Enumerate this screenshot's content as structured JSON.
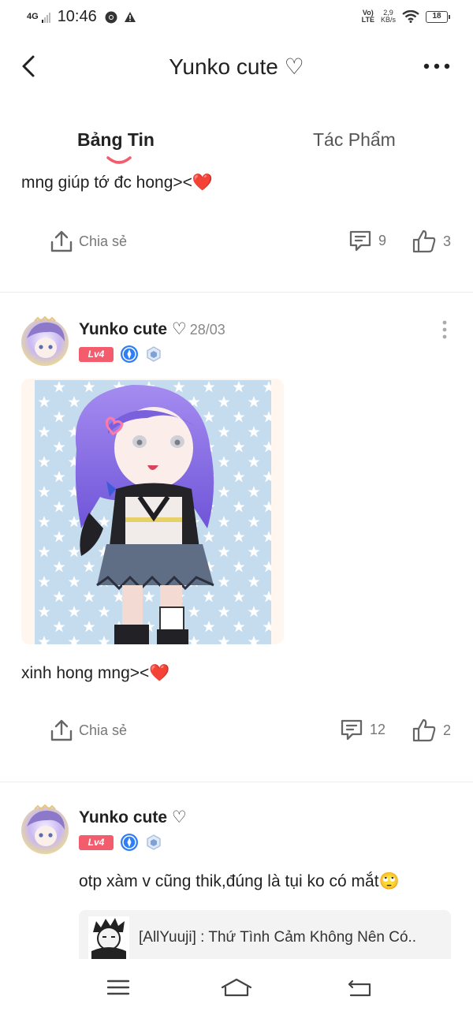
{
  "status_bar": {
    "signal": "4G",
    "time": "10:46",
    "volte_line1": "Vo)",
    "volte_line2": "LTE",
    "speed_value": "2,9",
    "speed_unit": "KB/s",
    "battery": "18"
  },
  "header": {
    "title": "Yunko cute ♡"
  },
  "tabs": [
    {
      "label": "Bảng Tin",
      "active": true
    },
    {
      "label": "Tác Phẩm",
      "active": false
    }
  ],
  "colors": {
    "accent": "#f25c6c",
    "badge_blue": "#2f7ef6",
    "text": "#222222",
    "muted": "#777777"
  },
  "posts": [
    {
      "text": "mng giúp tớ đc hong><❤️",
      "share_label": "Chia sẻ",
      "comments": "9",
      "likes": "3"
    },
    {
      "author": "Yunko cute ♡",
      "date": "28/03",
      "level": "Lv4",
      "text": "xinh hong mng><❤️",
      "share_label": "Chia sẻ",
      "comments": "12",
      "likes": "2"
    },
    {
      "author": "Yunko cute ♡",
      "level": "Lv4",
      "text": "otp xàm v cũng thik,đúng là tụi ko có mắt🙄",
      "linked_title": "[AllYuuji] : Thứ Tình Cảm Không Nên Có.."
    }
  ]
}
